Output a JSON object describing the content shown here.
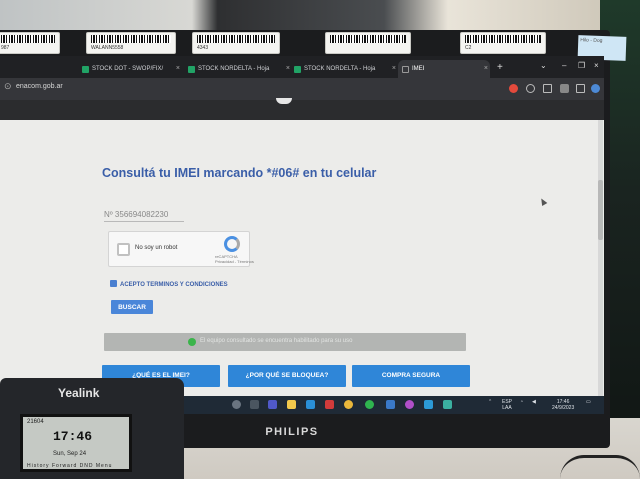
{
  "stickers": [
    "987",
    "WALANN5558",
    "4343",
    "",
    "C2"
  ],
  "postit": "Hilo - Dog",
  "browser": {
    "tabs": [
      {
        "label": "STOCK DOT - SWOP/FIX/"
      },
      {
        "label": "STOCK NORDELTA - Hoja"
      },
      {
        "label": "STOCK NORDELTA - Hoja"
      },
      {
        "label": "IMEI"
      }
    ],
    "new_tab": "+",
    "url": "enacom.gob.ar"
  },
  "page": {
    "heading": "Consultá tu IMEI marcando *#06# en tu celular",
    "imei_value": "Nº 356694082230",
    "recaptcha_label": "No soy un robot",
    "recaptcha_brand": "reCAPTCHA",
    "recaptcha_links": "Privacidad - Términos",
    "terms_label": "ACEPTO TERMINOS Y CONDICIONES",
    "search_button": "BUSCAR",
    "result_message": "El equipo consultado se encuentra habilitado para su uso",
    "nav_buttons": [
      "¿QUÉ ES EL IMEI?",
      "¿POR QUÉ SE BLOQUEA?",
      "COMPRA SEGURA"
    ]
  },
  "taskbar": {
    "lang": "ESP",
    "region": "LAA",
    "time": "17:46",
    "date": "24/9/2023"
  },
  "monitor_brand": "PHILIPS",
  "phone": {
    "brand": "Yealink",
    "ext": "21604",
    "time": "17:46",
    "date": "Sun, Sep 24",
    "softkeys": "History  Forward  DND  Menu"
  },
  "colors": {
    "accent": "#3a5ea8",
    "button": "#2f86d8",
    "success": "#3ab44a"
  }
}
